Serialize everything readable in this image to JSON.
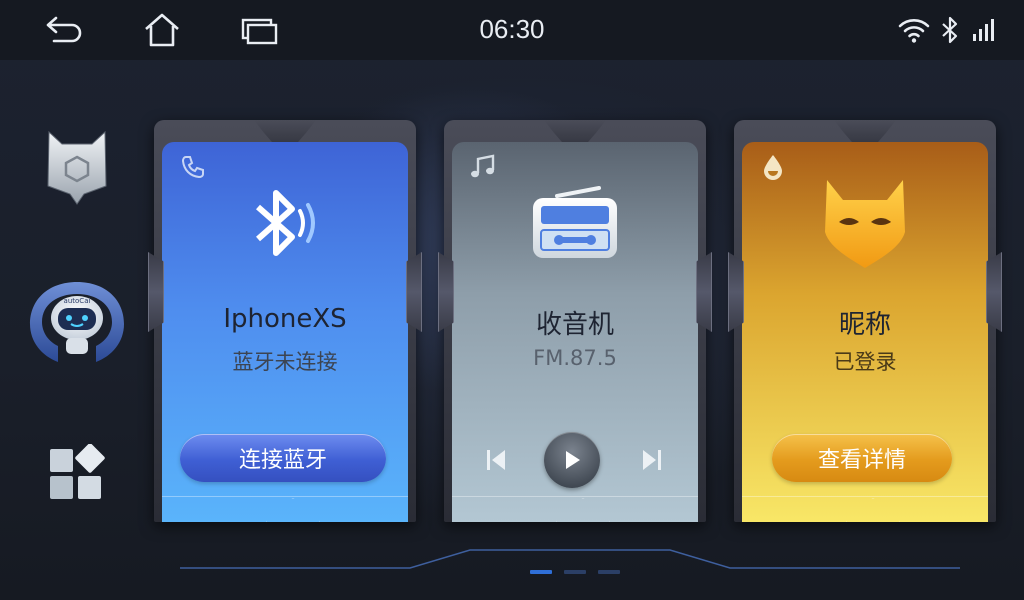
{
  "statusbar": {
    "time": "06:30",
    "icons": [
      "back-icon",
      "home-icon",
      "recent-apps-icon",
      "wifi-icon",
      "bluetooth-icon",
      "signal-icon"
    ]
  },
  "sidebar": {
    "items": [
      {
        "name": "hexagon-shield-icon"
      },
      {
        "name": "robot-assistant",
        "brand": "autoCai"
      },
      {
        "name": "apps-grid-icon"
      }
    ]
  },
  "cards": {
    "bluetooth": {
      "small_icon": "phone-icon",
      "big_icon": "bluetooth-icon",
      "title": "IphoneXS",
      "subtitle": "蓝牙未连接",
      "button": "连接蓝牙"
    },
    "radio": {
      "small_icon": "music-note-icon",
      "big_icon": "radio-icon",
      "title": "收音机",
      "subtitle": "FM.87.5",
      "controls": [
        "previous-icon",
        "play-icon",
        "next-icon"
      ]
    },
    "account": {
      "small_icon": "drop-icon",
      "big_icon": "bat-mask-icon",
      "title": "昵称",
      "subtitle": "已登录",
      "button": "查看详情"
    }
  },
  "pager": {
    "pages": 3,
    "current": 1
  },
  "colors": {
    "accent_blue": "#3f5fd4",
    "accent_gold": "#e49b1d",
    "page_active": "#2f6fd8",
    "page_inactive": "#2b3f66"
  }
}
